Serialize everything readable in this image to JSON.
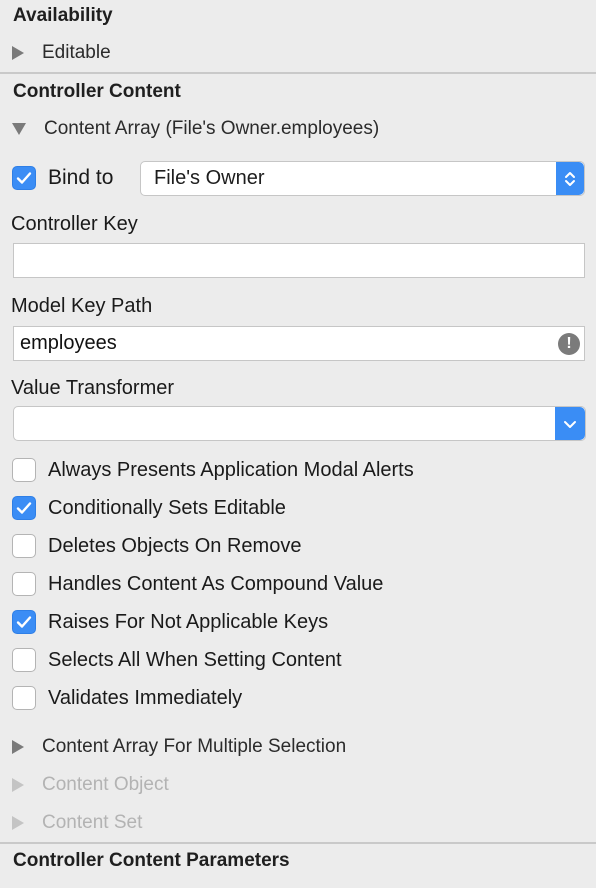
{
  "availability": {
    "title": "Availability",
    "editable_label": "Editable"
  },
  "controller_content": {
    "title": "Controller Content",
    "content_array_label": "Content Array (File's Owner.employees)",
    "bind_to": {
      "checked": true,
      "label": "Bind to",
      "selected": "File's Owner"
    },
    "controller_key": {
      "label": "Controller Key",
      "value": ""
    },
    "model_key_path": {
      "label": "Model Key Path",
      "value": "employees"
    },
    "value_transformer": {
      "label": "Value Transformer",
      "value": ""
    },
    "options": [
      {
        "label": "Always Presents Application Modal Alerts",
        "checked": false
      },
      {
        "label": "Conditionally Sets Editable",
        "checked": true
      },
      {
        "label": "Deletes Objects On Remove",
        "checked": false
      },
      {
        "label": "Handles Content As Compound Value",
        "checked": false
      },
      {
        "label": "Raises For Not Applicable Keys",
        "checked": true
      },
      {
        "label": "Selects All When Setting Content",
        "checked": false
      },
      {
        "label": "Validates Immediately",
        "checked": false
      }
    ],
    "content_array_multiple_label": "Content Array For Multiple Selection",
    "content_object_label": "Content Object",
    "content_set_label": "Content Set"
  },
  "controller_content_parameters": {
    "title": "Controller Content Parameters"
  },
  "colors": {
    "accent": "#3b8df5",
    "background": "#ececec",
    "warning_badge": "#7b7b7b"
  }
}
